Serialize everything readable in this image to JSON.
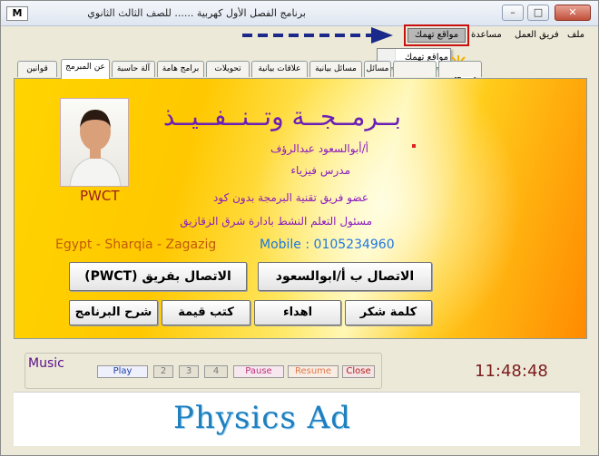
{
  "window": {
    "app_icon": "M",
    "title": "برنامج الفصل الأول كهربية ...... للصف الثالث الثانوي",
    "minimize": "–",
    "maximize": "□",
    "close": "✕"
  },
  "menu": {
    "items": [
      "ملف",
      "فريق العمل",
      "مساعدة",
      "مواقع تهمك"
    ],
    "highlighted": "مواقع تهمك",
    "dropdown_item": "مواقع تهمك"
  },
  "tabs": [
    "قوانين",
    "عن المبرمج",
    "آلة حاسبة",
    "برامج هامة",
    "تحويلات",
    "علاقات بيانية",
    "مسائل بيانية",
    "مسائل",
    "",
    ""
  ],
  "active_tab": "عن المبرمج",
  "profile": {
    "title": "بــرمــجــة  وتــنــفــيــذ",
    "name": "أ/أبوالسعود عبدالرؤف",
    "role": "مدرس فيزياء",
    "line1": "عضو فريق تقنية البرمجة بدون كود",
    "line2": "مسئول التعلم النشط بادارة شرق الزقازيق",
    "pwct": "PWCT",
    "location": "Egypt - Sharqia - Zagazig",
    "mobile": "Mobile : 0105234960"
  },
  "buttons": {
    "contact_pwct": "الاتصال بفريق (PWCT)",
    "contact_teacher": "الاتصال ب أ/ابوالسعود",
    "explain": "شرح البرنامج",
    "books": "كتب قيمة",
    "dedication": "اهداء",
    "thanks": "كلمة شكر"
  },
  "music": {
    "label": "Music",
    "play": "Play",
    "b2": "2",
    "b3": "3",
    "b4": "4",
    "pause": "Pause",
    "resume": "Resume",
    "close": "Close"
  },
  "clock": "11:48:48",
  "ad": "Physics Ad",
  "colors": {
    "accent_purple": "#8a1bc1",
    "highlight_red": "#c81010",
    "arrow_blue": "#1b2a8a"
  }
}
